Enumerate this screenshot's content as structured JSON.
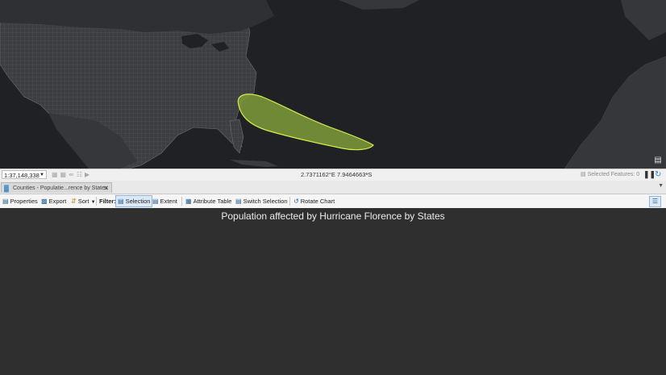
{
  "map": {
    "background": "#1f2125",
    "land_color": "#3a3c40",
    "cone_fill": "#7e9b3a",
    "cone_stroke": "#d6ef4b",
    "tool_icon": "basemap-icon"
  },
  "status_bar": {
    "scale": "1:37,148,338",
    "coordinates": "2.7371162°E 7.9464663°S",
    "selected_features": "Selected Features: 0"
  },
  "tab": {
    "label": "Counties - Populatie...rence by States"
  },
  "toolbar": {
    "properties": "Properties",
    "export": "Export",
    "sort": "Sort",
    "filter_label": "Filter:",
    "selection": "Selection",
    "extent": "Extent",
    "attribute_table": "Attribute Table",
    "switch_selection": "Switch Selection",
    "rotate_chart": "Rotate Chart"
  },
  "chart": {
    "title": "Population affected by Hurricane Florence by States"
  }
}
